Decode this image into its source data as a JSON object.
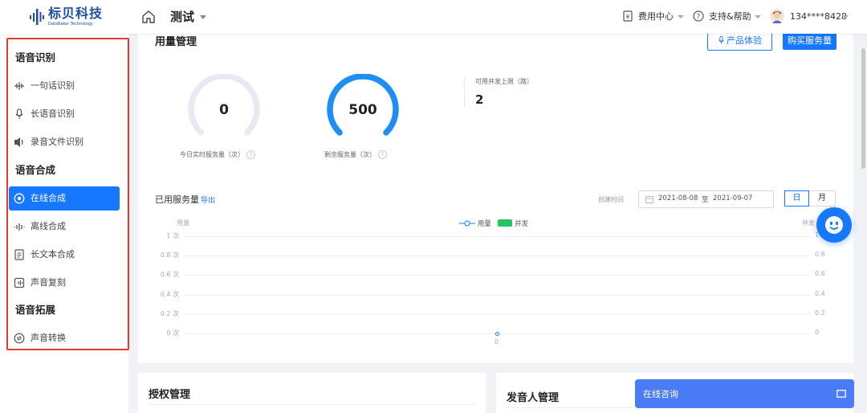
{
  "brand": {
    "name_cn": "标贝科技",
    "name_en": "DataBaker Technology"
  },
  "header": {
    "project": "测试",
    "nav": [
      "费用中心",
      "支持&帮助"
    ],
    "user": "134****8428"
  },
  "sidebar": {
    "sections": [
      {
        "title": "语音识别",
        "items": [
          {
            "label": "一句话识别",
            "icon": "waveform-icon"
          },
          {
            "label": "长语音识别",
            "icon": "microphone-icon"
          },
          {
            "label": "录音文件识别",
            "icon": "audio-file-icon"
          }
        ]
      },
      {
        "title": "语音合成",
        "items": [
          {
            "label": "在线合成",
            "icon": "online-synthesis-icon",
            "active": true
          },
          {
            "label": "离线合成",
            "icon": "offline-wave-icon"
          },
          {
            "label": "长文本合成",
            "icon": "document-icon"
          },
          {
            "label": "声音复刻",
            "icon": "voice-clone-icon"
          }
        ]
      },
      {
        "title": "语音拓展",
        "items": [
          {
            "label": "声音转换",
            "icon": "voice-convert-icon"
          }
        ]
      }
    ]
  },
  "usage": {
    "title": "用量管理",
    "experience_button": "产品体验",
    "buy_button": "购买服务量",
    "today_value": "0",
    "today_label": "今日实时服务量（次）",
    "today_progress": 0,
    "remaining_value": "500",
    "remaining_label": "剩余服务量（次）",
    "remaining_progress": 1,
    "concurrency_label": "可用并发上限（路）",
    "concurrency_value": "2"
  },
  "used": {
    "title": "已用服务量",
    "export": "导出",
    "created_label": "创建时间",
    "date_start": "2021-08-08",
    "date_sep": "至",
    "date_end": "2021-09-07",
    "toggle_day": "日",
    "toggle_month": "月"
  },
  "chart_data": {
    "type": "line",
    "left_axis_label": "用量",
    "right_axis_label": "并发",
    "legend": [
      "用量",
      "并发"
    ],
    "left_ticks": [
      "1 次",
      "0.8 次",
      "0.6 次",
      "0.4 次",
      "0.2 次",
      "0 次"
    ],
    "right_ticks": [
      "1",
      "0.8",
      "0.6",
      "0.4",
      "0.2",
      "0"
    ],
    "categories": [
      "0"
    ],
    "series": [
      {
        "name": "用量",
        "values": [
          0
        ]
      },
      {
        "name": "并发",
        "values": [
          0
        ]
      }
    ],
    "ylim": [
      0,
      1
    ],
    "colors": {
      "usage": "#1677ff",
      "concurrency": "#22c55e"
    }
  },
  "bottom": {
    "auth_title": "授权管理",
    "speaker_title": "发音人管理",
    "consult_label": "在线咨询"
  }
}
